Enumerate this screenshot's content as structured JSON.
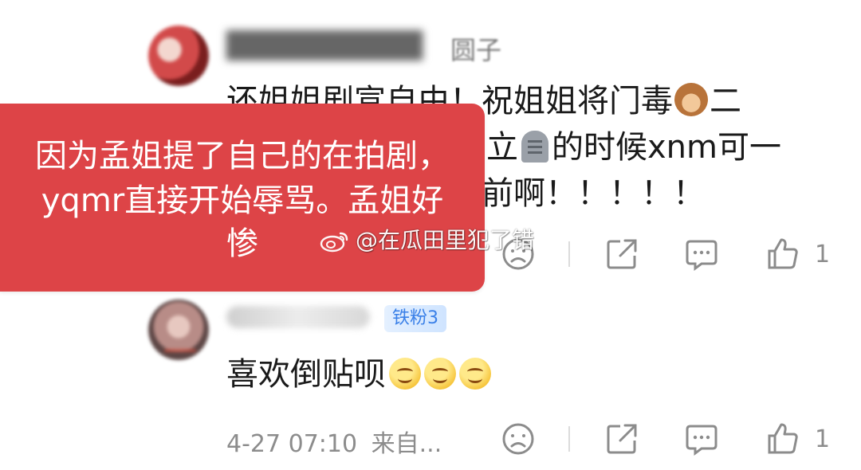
{
  "comments": [
    {
      "username_visible_tail": "圆子",
      "text_lines": [
        "还姐姐剧宣自由！祝姐姐将门毒",
        "立",
        "前啊！！！！！"
      ],
      "text_line1_suffix": "二",
      "text_line2_suffix": "的时候xnm可一",
      "likes": "1"
    },
    {
      "badge": "铁粉3",
      "text": "喜欢倒贴呗",
      "time": "4-27 07:10",
      "source": "来自...",
      "likes": "1"
    }
  ],
  "overlay": {
    "lines": [
      "因为孟姐提了自己的在拍剧，",
      "yqmr直接开始辱骂。孟姐好",
      "惨"
    ],
    "color": "#dd4447"
  },
  "watermark": {
    "text": "@在瓜田里犯了错"
  },
  "icons": [
    "sad-face-icon",
    "share-icon",
    "comment-icon",
    "thumbs-up-icon",
    "weibo-logo-icon"
  ]
}
